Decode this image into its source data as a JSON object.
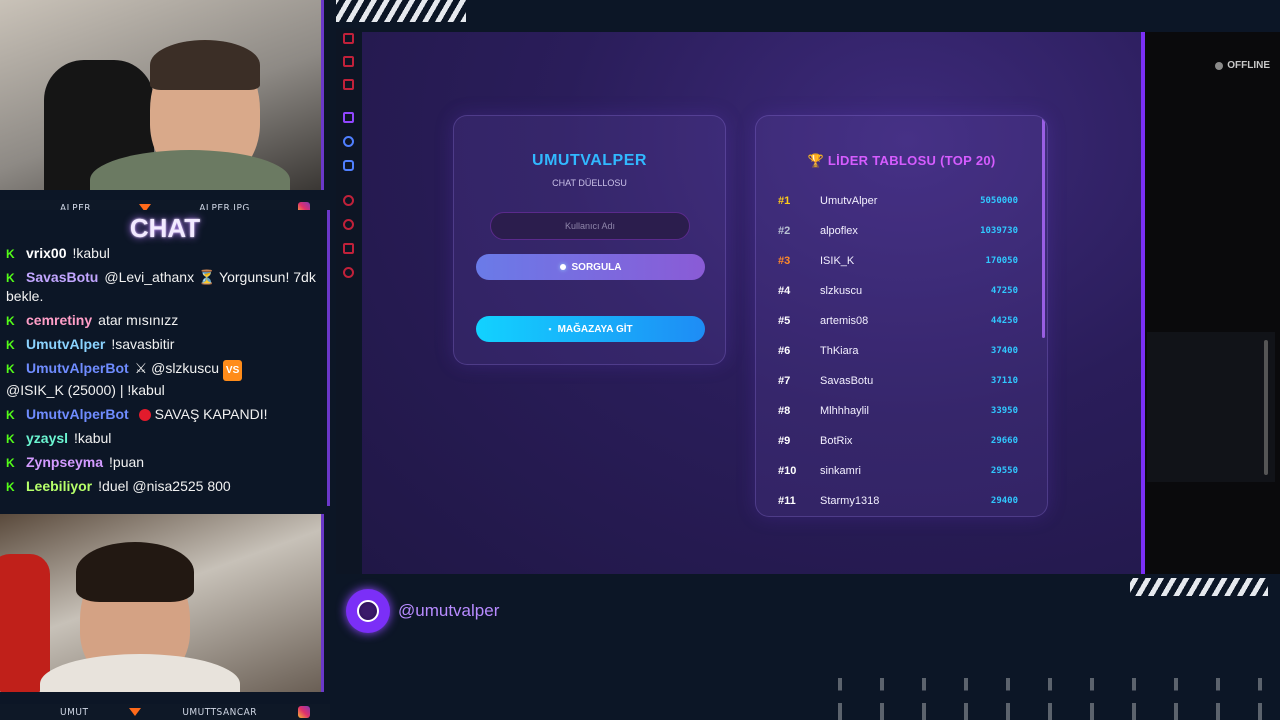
{
  "cams": {
    "top": {
      "left_label": "ALPER",
      "right_label": "ALPER.JPG"
    },
    "bottom": {
      "left_label": "UMUT",
      "right_label": "UMUTTSANCAR"
    }
  },
  "chat": {
    "title": "CHAT",
    "messages": [
      {
        "user": "vrix00",
        "color": "#ffffff",
        "text": "!kabul"
      },
      {
        "user": "SavasBotu",
        "color": "#c2a6ff",
        "text": "@Levi_athanx ⏳ Yorgunsun! 7dk bekle."
      },
      {
        "user": "cemretiny",
        "color": "#ff9ec7",
        "text": "atar mısınızz"
      },
      {
        "user": "UmutvAlper",
        "color": "#8bd3ff",
        "text": "!savasbitir"
      },
      {
        "user": "UmutvAlperBot",
        "color": "#6f8cff",
        "text": "⚔ @slzkuscu",
        "badge": "VS",
        "text2": "@ISIK_K (25000) | !kabul"
      },
      {
        "user": "UmutvAlperBot",
        "color": "#6f8cff",
        "text": "SAVAŞ KAPANDI!",
        "reddot": true
      },
      {
        "user": "yzaysl",
        "color": "#6bf5d1",
        "text": "!kabul"
      },
      {
        "user": "Zynpseyma",
        "color": "#d39bff",
        "text": "!puan"
      },
      {
        "user": "Leebiliyor",
        "color": "#b6ff6a",
        "text": "!duel @nisa2525 800"
      }
    ]
  },
  "login": {
    "title": "UMUTVALPER",
    "subtitle": "CHAT DÜELLOSU",
    "username_placeholder": "Kullanıcı Adı",
    "query_label": "SORGULA",
    "shop_label": "MAĞAZAYA GİT"
  },
  "leaderboard": {
    "title": "🏆 LİDER TABLOSU (TOP 20)",
    "rows": [
      {
        "rank": "#1",
        "name": "UmutvAlper",
        "score": "5050000"
      },
      {
        "rank": "#2",
        "name": "alpoflex",
        "score": "1039730"
      },
      {
        "rank": "#3",
        "name": "ISIK_K",
        "score": "170050"
      },
      {
        "rank": "#4",
        "name": "slzkuscu",
        "score": "47250"
      },
      {
        "rank": "#5",
        "name": "artemis08",
        "score": "44250"
      },
      {
        "rank": "#6",
        "name": "ThKiara",
        "score": "37400"
      },
      {
        "rank": "#7",
        "name": "SavasBotu",
        "score": "37110"
      },
      {
        "rank": "#8",
        "name": "Mlhhhaylil",
        "score": "33950"
      },
      {
        "rank": "#9",
        "name": "BotRix",
        "score": "29660"
      },
      {
        "rank": "#10",
        "name": "sinkamri",
        "score": "29550"
      },
      {
        "rank": "#11",
        "name": "Starmy1318",
        "score": "29400"
      }
    ]
  },
  "status": {
    "offline_label": "OFFLINE"
  },
  "handle": {
    "text": "@umutvalper"
  }
}
